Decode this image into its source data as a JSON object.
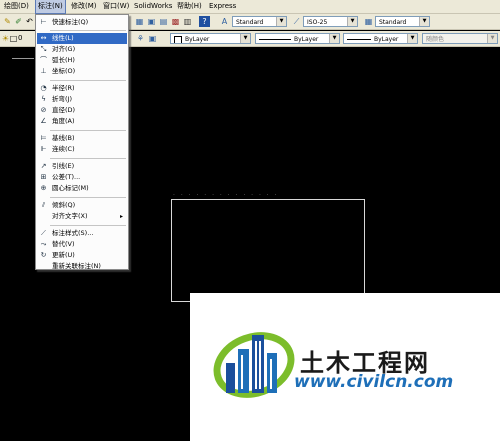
{
  "menubar": {
    "items": [
      "绘图(D)",
      "标注(N)",
      "修改(M)",
      "窗口(W)",
      "SolidWorks",
      "帮助(H)",
      "Express"
    ]
  },
  "toolbar1": {
    "text_style": "Standard",
    "dim_style": "ISO-25",
    "table_style": "Standard"
  },
  "toolbar2": {
    "layer": "0",
    "color": "ByLayer",
    "linetype": "ByLayer",
    "lineweight": "ByLayer",
    "plot_style": "随颜色"
  },
  "dimension_menu": {
    "items": [
      {
        "label": "快速标注(Q)",
        "icon": "quick-dim-icon"
      },
      {
        "label": "线性(L)",
        "icon": "linear-dim-icon"
      },
      {
        "label": "对齐(G)",
        "icon": "aligned-dim-icon"
      },
      {
        "label": "弧长(H)",
        "icon": "arc-length-icon"
      },
      {
        "label": "坐标(O)",
        "icon": "ordinate-icon"
      },
      {
        "label": "半径(R)",
        "icon": "radius-icon"
      },
      {
        "label": "折弯(J)",
        "icon": "jogged-icon"
      },
      {
        "label": "直径(D)",
        "icon": "diameter-icon"
      },
      {
        "label": "角度(A)",
        "icon": "angle-icon"
      },
      {
        "label": "基线(B)",
        "icon": "baseline-icon"
      },
      {
        "label": "连续(C)",
        "icon": "continue-icon"
      },
      {
        "label": "引线(E)",
        "icon": "leader-icon"
      },
      {
        "label": "公差(T)...",
        "icon": "tolerance-icon"
      },
      {
        "label": "圆心标记(M)",
        "icon": "center-mark-icon"
      },
      {
        "label": "倾斜(Q)",
        "icon": "oblique-icon"
      },
      {
        "label": "对齐文字(X)",
        "icon": "",
        "submenu": "▸"
      },
      {
        "label": "标注样式(S)...",
        "icon": "dim-style-icon"
      },
      {
        "label": "替代(V)",
        "icon": "override-icon"
      },
      {
        "label": "更新(U)",
        "icon": "update-icon"
      },
      {
        "label": "重新关联标注(N)",
        "icon": ""
      }
    ]
  },
  "logo": {
    "title": "土木工程网",
    "url": "www.civilcn.com",
    "colors": {
      "blue": "#1e6fb8",
      "green": "#7cbd2b",
      "dark_blue": "#1b4f9c"
    }
  }
}
